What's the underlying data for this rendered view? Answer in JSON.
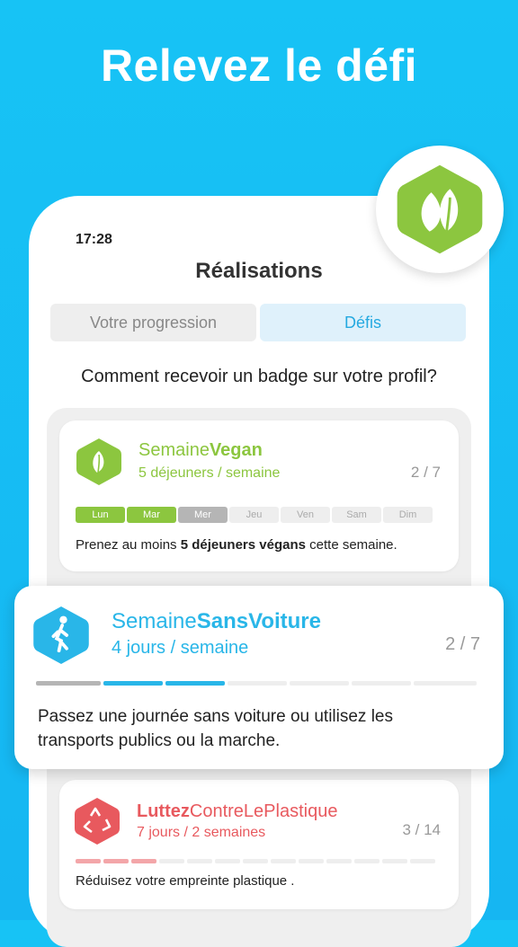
{
  "headline": "Relevez le défi",
  "status": {
    "time": "17:28"
  },
  "screen": {
    "title": "Réalisations"
  },
  "tabs": [
    {
      "label": "Votre progression",
      "active": false
    },
    {
      "label": "Défis",
      "active": true
    }
  ],
  "question": "Comment recevoir un badge sur votre profil?",
  "cards": {
    "vegan": {
      "title_prefix": "Semaine",
      "title_strong": "Vegan",
      "subtitle": "5 déjeuners / semaine",
      "count": "2 / 7",
      "days": [
        "Lun",
        "Mar",
        "Mer",
        "Jeu",
        "Ven",
        "Sam",
        "Dim"
      ],
      "desc_pre": "Prenez au moins ",
      "desc_bold": "5 déjeuners végans",
      "desc_post": " cette semaine.",
      "color": "#8cc63f",
      "icon": "leaf-icon"
    },
    "sansvoiture": {
      "title_prefix": "Semaine",
      "title_strong": "SansVoiture",
      "subtitle": "4 jours / semaine",
      "count": "2 / 7",
      "desc": "Passez une journée sans voiture ou utilisez les transports publics ou la marche.",
      "color": "#29b6e8",
      "icon": "walking-person-icon"
    },
    "plastique": {
      "title_strong": "Luttez",
      "title_suffix": "ContreLePlastique",
      "subtitle": "7 jours / 2 semaines",
      "count": "3 / 14",
      "desc": "Réduisez votre empreinte plastique .",
      "color": "#e8595e",
      "icon": "recycle-icon"
    }
  },
  "top_badge": {
    "icon": "leaf-badge-icon",
    "color": "#8cc63f"
  }
}
